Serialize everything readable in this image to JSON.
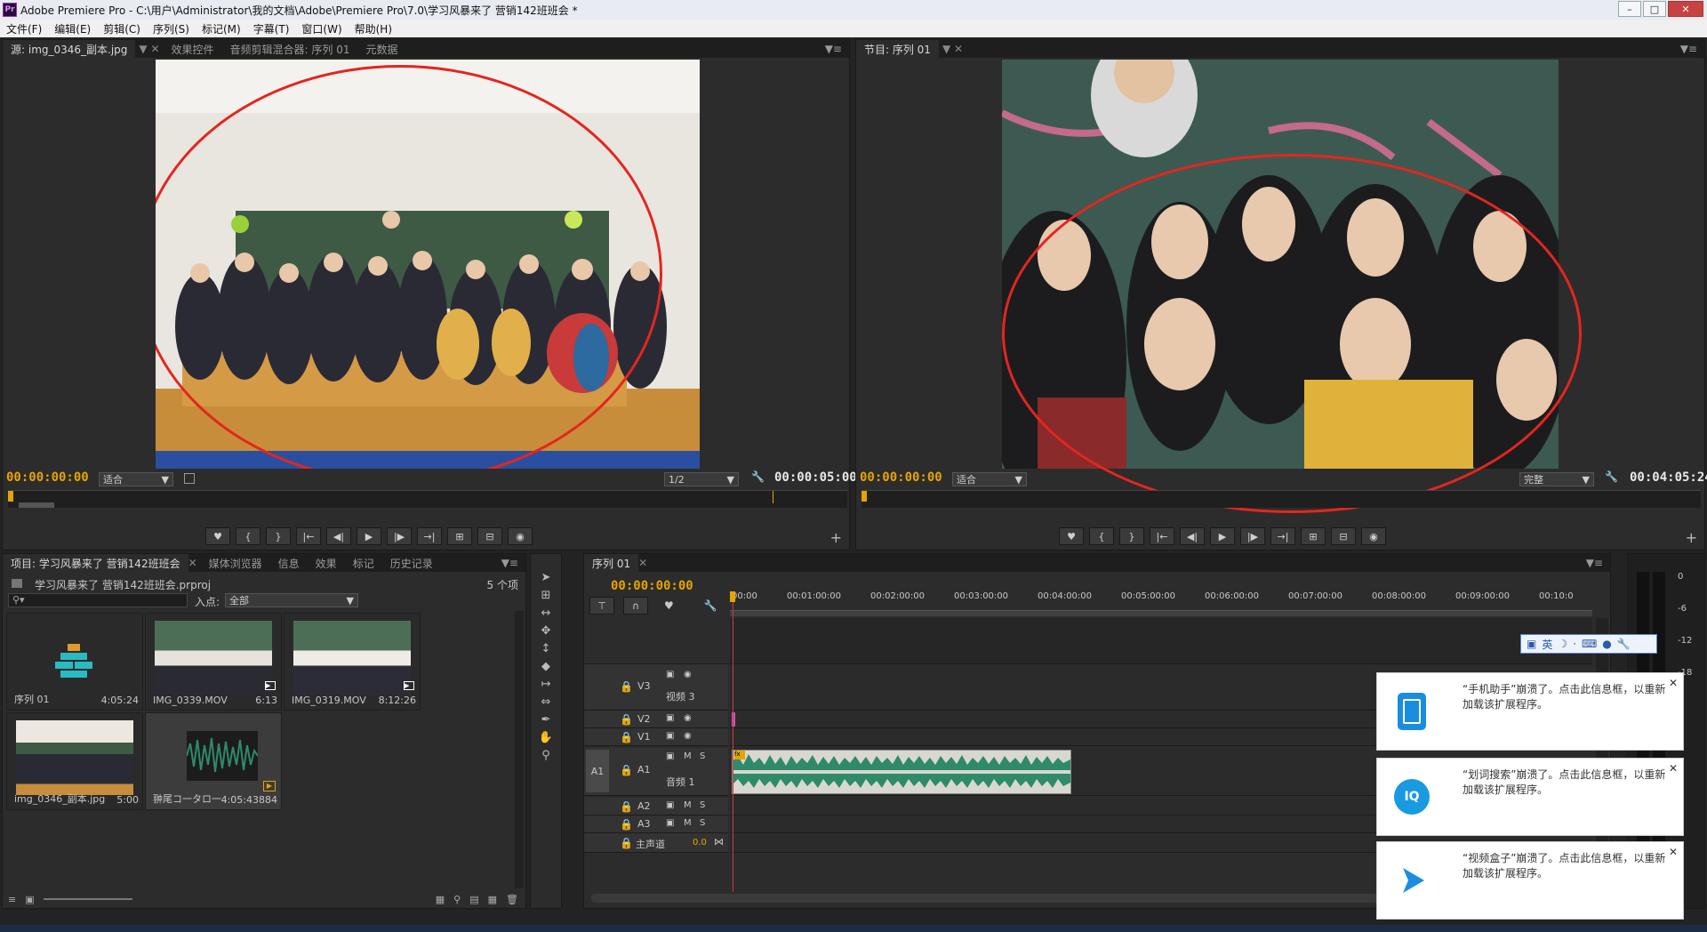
{
  "window": {
    "title": "Adobe Premiere Pro - C:\\用户\\Administrator\\我的文档\\Adobe\\Premiere Pro\\7.0\\学习风暴来了 营销142班班会 *",
    "logo": "Pr"
  },
  "menu": [
    "文件(F)",
    "编辑(E)",
    "剪辑(C)",
    "序列(S)",
    "标记(M)",
    "字幕(T)",
    "窗口(W)",
    "帮助(H)"
  ],
  "source_panel": {
    "tabs": [
      "源: img_0346_副本.jpg",
      "效果控件",
      "音频剪辑混合器: 序列 01",
      "元数据"
    ],
    "timecode_in": "00:00:00:00",
    "fit": "适合",
    "resolution": "1/2",
    "duration": "00:00:05:00"
  },
  "program_panel": {
    "tabs": [
      "节目: 序列 01"
    ],
    "timecode_in": "00:00:00:00",
    "fit": "适合",
    "quality": "完整",
    "duration": "00:04:05:24"
  },
  "project_panel": {
    "tabs": [
      "项目: 学习风暴来了 营销142班班会",
      "媒体浏览器",
      "信息",
      "效果",
      "标记",
      "历史记录"
    ],
    "file": "学习风暴来了 营销142班班会.prproj",
    "count": "5 个项",
    "inpoint_label": "入点:",
    "inpoint_value": "全部",
    "items": [
      {
        "name": "序列 01",
        "duration": "4:05:24"
      },
      {
        "name": "IMG_0339.MOV",
        "duration": "6:13"
      },
      {
        "name": "IMG_0319.MOV",
        "duration": "8:12:26"
      },
      {
        "name": "img_0346_副本.jpg",
        "duration": "5:00"
      },
      {
        "name": "翀尾コ一タロ一",
        "duration": "4:05:43884"
      }
    ]
  },
  "timeline": {
    "tab": "序列 01",
    "timecode": "00:00:00:00",
    "ruler": [
      "00:00",
      "00:01:00:00",
      "00:02:00:00",
      "00:03:00:00",
      "00:04:00:00",
      "00:05:00:00",
      "00:06:00:00",
      "00:07:00:00",
      "00:08:00:00",
      "00:09:00:00",
      "00:10:0"
    ],
    "tracks": {
      "v3": "V3",
      "v3name": "视频 3",
      "v2": "V2",
      "v1": "V1",
      "a1src": "A1",
      "a1": "A1",
      "a1name": "音频 1",
      "a2": "A2",
      "a3": "A3",
      "master": "主声道",
      "master_val": "0.0"
    },
    "mute": "M",
    "solo": "S"
  },
  "audio_meter": {
    "labels": [
      "0",
      "-6",
      "-12",
      "-18"
    ]
  },
  "ime_toolbar": {
    "lang": "英"
  },
  "notifications": [
    {
      "text": "“手机助手”崩溃了。点击此信息框，以重新加载该扩展程序。",
      "icon": "phone-icon"
    },
    {
      "text": "“划词搜索”崩溃了。点击此信息框，以重新加载该扩展程序。",
      "icon": "search-iq-icon"
    },
    {
      "text": "“视频盒子”崩溃了。点击此信息框，以重新加载该扩展程序。",
      "icon": "play-icon"
    }
  ],
  "colors": {
    "accent_timecode": "#e5a400",
    "annotation_red": "#e3261f",
    "audio_clip": "#2f8a6a"
  }
}
